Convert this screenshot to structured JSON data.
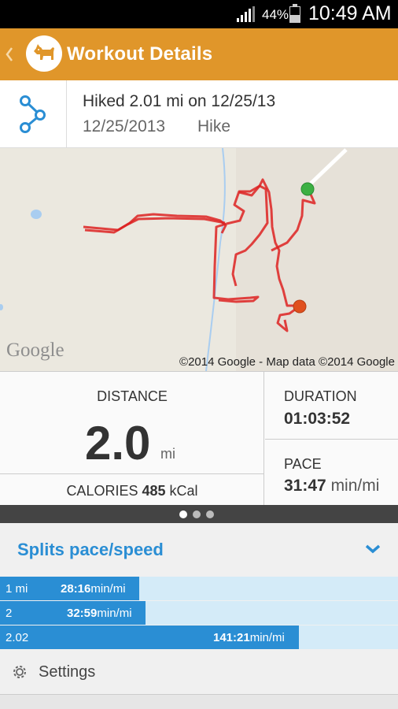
{
  "status_bar": {
    "battery_pct": "44%",
    "time": "10:49 AM"
  },
  "action_bar": {
    "title": "Workout Details",
    "logo_icon": "dog-icon"
  },
  "workout": {
    "title": "Hiked 2.01 mi on 12/25/13",
    "date": "12/25/2013",
    "type": "Hike"
  },
  "map": {
    "google_logo": "Google",
    "copyright": "©2014 Google - Map data ©2014 Google"
  },
  "stats": {
    "distance_label": "DISTANCE",
    "distance_value": "2.0",
    "distance_unit": "mi",
    "calories_label": "CALORIES",
    "calories_value": "485",
    "calories_unit": "kCal",
    "duration_label": "DURATION",
    "duration_value": "01:03:52",
    "pace_label": "PACE",
    "pace_value": "31:47",
    "pace_unit": "min/mi"
  },
  "pager": {
    "pages": 3,
    "active": 0
  },
  "splits": {
    "title": "Splits pace/speed",
    "rows": [
      {
        "label": "1 mi",
        "value": "28:16",
        "unit": "min/mi",
        "fill": 0.35
      },
      {
        "label": "2",
        "value": "32:59",
        "unit": "min/mi",
        "fill": 0.366
      },
      {
        "label": "2.02",
        "value": "141:21",
        "unit": "min/mi",
        "fill": 0.75
      }
    ]
  },
  "settings": {
    "label": "Settings"
  },
  "colors": {
    "accent_orange": "#e0962a",
    "accent_blue": "#2a8ed4",
    "route_red": "#dd2222",
    "start_green": "#3cb043",
    "end_orange": "#e0501e"
  }
}
